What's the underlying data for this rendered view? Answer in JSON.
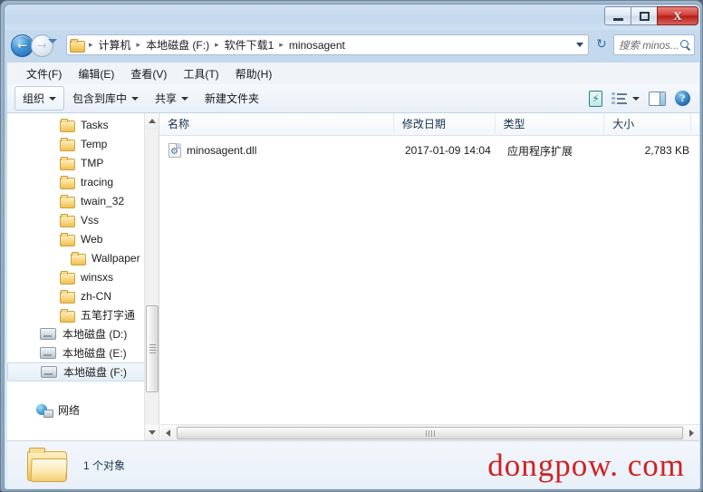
{
  "window": {
    "title": "",
    "controls": {
      "minimize_label": "–",
      "maximize_label": "□",
      "close_label": "X"
    }
  },
  "nav": {
    "back_label": "←",
    "forward_label": "→",
    "recent_dropdown_label": "▼",
    "refresh_label": "↻"
  },
  "address": {
    "folder_icon": "folder-icon",
    "crumbs": [
      {
        "label": "计算机"
      },
      {
        "label": "本地磁盘 (F:)"
      },
      {
        "label": "软件下载1"
      },
      {
        "label": "minosagent"
      }
    ],
    "separator": "▸",
    "dropdown_label": "▼"
  },
  "search": {
    "placeholder": "搜索 minos...",
    "value": "",
    "icon": "search-icon"
  },
  "menubar": {
    "items": [
      {
        "label": "文件(F)"
      },
      {
        "label": "编辑(E)"
      },
      {
        "label": "查看(V)"
      },
      {
        "label": "工具(T)"
      },
      {
        "label": "帮助(H)"
      }
    ]
  },
  "toolbar": {
    "organize_label": "组织",
    "include_library_label": "包含到库中",
    "share_label": "共享",
    "new_folder_label": "新建文件夹",
    "help_glyph": "?",
    "icons": {
      "burn": "burn-icon",
      "view": "view-options-icon",
      "preview": "preview-pane-icon",
      "help": "help-icon"
    }
  },
  "sidebar": {
    "items": [
      {
        "label": "Tasks",
        "icon": "folder-icon",
        "type": "folder",
        "indent": 0,
        "selected": false
      },
      {
        "label": "Temp",
        "icon": "folder-icon",
        "type": "folder",
        "indent": 0,
        "selected": false
      },
      {
        "label": "TMP",
        "icon": "folder-icon",
        "type": "folder",
        "indent": 0,
        "selected": false
      },
      {
        "label": "tracing",
        "icon": "folder-icon",
        "type": "folder",
        "indent": 0,
        "selected": false
      },
      {
        "label": "twain_32",
        "icon": "folder-icon",
        "type": "folder",
        "indent": 0,
        "selected": false
      },
      {
        "label": "Vss",
        "icon": "folder-icon",
        "type": "folder",
        "indent": 0,
        "selected": false
      },
      {
        "label": "Web",
        "icon": "folder-icon",
        "type": "folder",
        "indent": 0,
        "selected": false
      },
      {
        "label": "Wallpaper",
        "icon": "folder-icon",
        "type": "folder",
        "indent": 1,
        "selected": false
      },
      {
        "label": "winsxs",
        "icon": "folder-icon",
        "type": "folder",
        "indent": 0,
        "selected": false
      },
      {
        "label": "zh-CN",
        "icon": "folder-icon",
        "type": "folder",
        "indent": 0,
        "selected": false
      },
      {
        "label": "五笔打字通",
        "icon": "folder-icon",
        "type": "folder",
        "indent": 0,
        "selected": false
      },
      {
        "label": "本地磁盘 (D:)",
        "icon": "drive-icon",
        "type": "drive",
        "indent": 0,
        "selected": false
      },
      {
        "label": "本地磁盘 (E:)",
        "icon": "drive-icon",
        "type": "drive",
        "indent": 0,
        "selected": false
      },
      {
        "label": "本地磁盘 (F:)",
        "icon": "drive-icon",
        "type": "drive",
        "indent": 0,
        "selected": true
      },
      {
        "label": "网络",
        "icon": "network-icon",
        "type": "network",
        "indent": 0,
        "selected": false
      }
    ]
  },
  "filelist": {
    "columns": [
      {
        "label": "名称",
        "key": "name"
      },
      {
        "label": "修改日期",
        "key": "date"
      },
      {
        "label": "类型",
        "key": "type"
      },
      {
        "label": "大小",
        "key": "size"
      }
    ],
    "rows": [
      {
        "name": "minosagent.dll",
        "date": "2017-01-09 14:04",
        "type": "应用程序扩展",
        "size": "2,783 KB",
        "icon": "dll-file-icon"
      }
    ]
  },
  "statusbar": {
    "item_count_text": "1 个对象",
    "folder_icon": "folder-large-icon"
  },
  "watermark": {
    "text": "dongpow. com",
    "color": "#cf2222"
  },
  "scrollbars": {
    "up_label": "▲",
    "down_label": "▼",
    "left_label": "◀",
    "right_label": "▶"
  }
}
